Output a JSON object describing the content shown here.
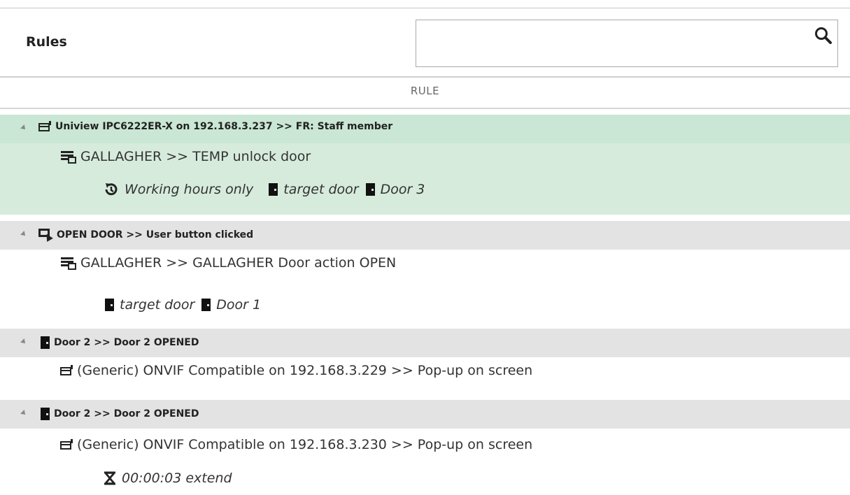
{
  "header": {
    "title": "Rules",
    "search": {
      "value": "",
      "placeholder": ""
    }
  },
  "table": {
    "column_header": "RULE",
    "rules": [
      {
        "trigger": "Uniview IPC6222ER-X on 192.168.3.237 >> FR: Staff member",
        "trigger_icon": "camera-icon",
        "action": "GALLAGHER >> TEMP unlock door",
        "action_icon": "server-icon",
        "params": [
          {
            "icon": "clock-history-icon",
            "text": "Working hours only"
          },
          {
            "icon": "door-icon",
            "text": "target door"
          },
          {
            "icon": "door-icon",
            "text": "Door 3"
          }
        ]
      },
      {
        "trigger": "OPEN DOOR >> User button clicked",
        "trigger_icon": "monitor-cursor-icon",
        "action": "GALLAGHER >> GALLAGHER Door action OPEN",
        "action_icon": "server-icon",
        "params": [
          {
            "icon": "door-icon",
            "text": "target door"
          },
          {
            "icon": "door-icon",
            "text": "Door 1"
          }
        ]
      },
      {
        "trigger": "Door 2 >> Door 2 OPENED",
        "trigger_icon": "door-icon",
        "action": "(Generic) ONVIF Compatible on 192.168.3.229 >> Pop-up on screen",
        "action_icon": "camera-icon",
        "params": []
      },
      {
        "trigger": "Door 2 >> Door 2 OPENED",
        "trigger_icon": "door-icon",
        "action": "(Generic) ONVIF Compatible on 192.168.3.230 >> Pop-up on screen",
        "action_icon": "camera-icon",
        "params": [
          {
            "icon": "hourglass-icon",
            "text": "00:00:03 extend"
          }
        ]
      }
    ]
  },
  "colors": {
    "selected_trigger_bg": "#c9e7d4",
    "selected_body_bg": "#d6ebdc",
    "trigger_bg": "#e3e3e3"
  }
}
